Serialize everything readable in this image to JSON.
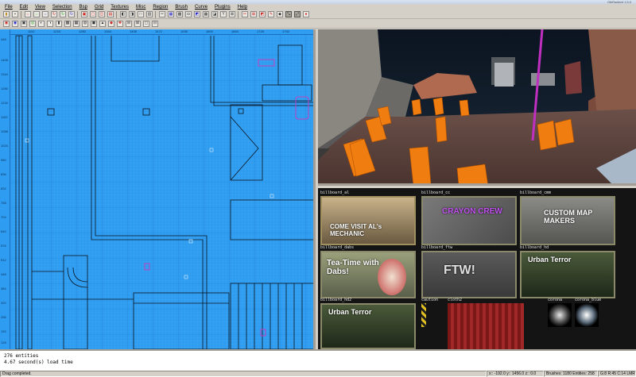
{
  "window": {
    "title": "GtkRadiant 1.5.0"
  },
  "menu": [
    "File",
    "Edit",
    "View",
    "Selection",
    "Bsp",
    "Grid",
    "Textures",
    "Misc",
    "Region",
    "Brush",
    "Curve",
    "Plugins",
    "Help"
  ],
  "toolbar1_icons": [
    "open-icon",
    "save-icon",
    "flip-x-icon",
    "flip-y-icon",
    "flip-z-icon",
    "rotate-x-icon",
    "rotate-y-icon",
    "rotate-z-icon",
    "select-complete-tall-icon",
    "select-touching-icon",
    "select-partial-tall-icon",
    "select-inside-icon",
    "csg-subtract-icon",
    "csg-merge-icon",
    "make-hollow-icon",
    "make-room-icon",
    "clipper-icon",
    "change-view-icon",
    "texture-lock-icon",
    "camera-icon",
    "cube-clip-icon",
    "entities-icon",
    "patch-icon",
    "brush-icon",
    "vertex-icon",
    "translate-icon",
    "rotate-icon",
    "scale-icon",
    "drag-icon",
    "plugin-icon"
  ],
  "toolbar2_icons": [
    "bob-icon",
    "ctrl-icon",
    "tex-fit-icon",
    "capped-icon",
    "bevel-icon",
    "endcap-icon",
    "cylinder-icon",
    "dense-icon",
    "very-dense-icon",
    "square-icon",
    "matrix-icon",
    "weld-icon",
    "drop-icon",
    "redisperse-icon",
    "inverted-icon",
    "thicken-icon",
    "cap-icon",
    "select-all-icon"
  ],
  "xy_ruler_left": [
    "448",
    "1408",
    "1344",
    "1280",
    "1216",
    "1152",
    "1088",
    "1024",
    "960",
    "896",
    "832",
    "768",
    "704",
    "640",
    "576",
    "512",
    "448",
    "384",
    "320",
    "256",
    "192",
    "128",
    "64"
  ],
  "xy_ruler_top": [
    "1152",
    "1216",
    "1280",
    "1344",
    "1408",
    "1472",
    "1536",
    "1600",
    "1664",
    "1728",
    "1792"
  ],
  "textures": [
    {
      "label": "billboard_al",
      "caption": "COME VISIT AL's MECHANIC"
    },
    {
      "label": "billboard_cc",
      "caption": "CRAYON CREW"
    },
    {
      "label": "billboard_cmm",
      "caption": "CUSTOM MAP MAKERS"
    },
    {
      "label": "billboard_dabs",
      "caption": "Tea-Time with Dabs!"
    },
    {
      "label": "billboard_ftw",
      "caption": "FTW!"
    },
    {
      "label": "billboard_hd",
      "caption": "Urban Terror"
    },
    {
      "label": "billboard_hd2",
      "caption": "Urban Terror"
    },
    {
      "label": "caution",
      "caption": ""
    },
    {
      "label": "cloth2",
      "caption": ""
    },
    {
      "label": "corona",
      "caption": ""
    },
    {
      "label": "corona_blue",
      "caption": ""
    }
  ],
  "console": [
    "  276 entities",
    "  4.67 second(s) load time"
  ],
  "status": {
    "message": "Drag completed.",
    "coords": "x:: -192.0  y:: 1456.0  z:: 0.0",
    "counts": "Brushes: 1180 Entities: 258",
    "grid": "G:8 R:45 C:14 LMR"
  },
  "colors": {
    "xy_bg": "#2e9cf0",
    "cam_box": "#f07d10",
    "console_bg": "#ffffff"
  }
}
